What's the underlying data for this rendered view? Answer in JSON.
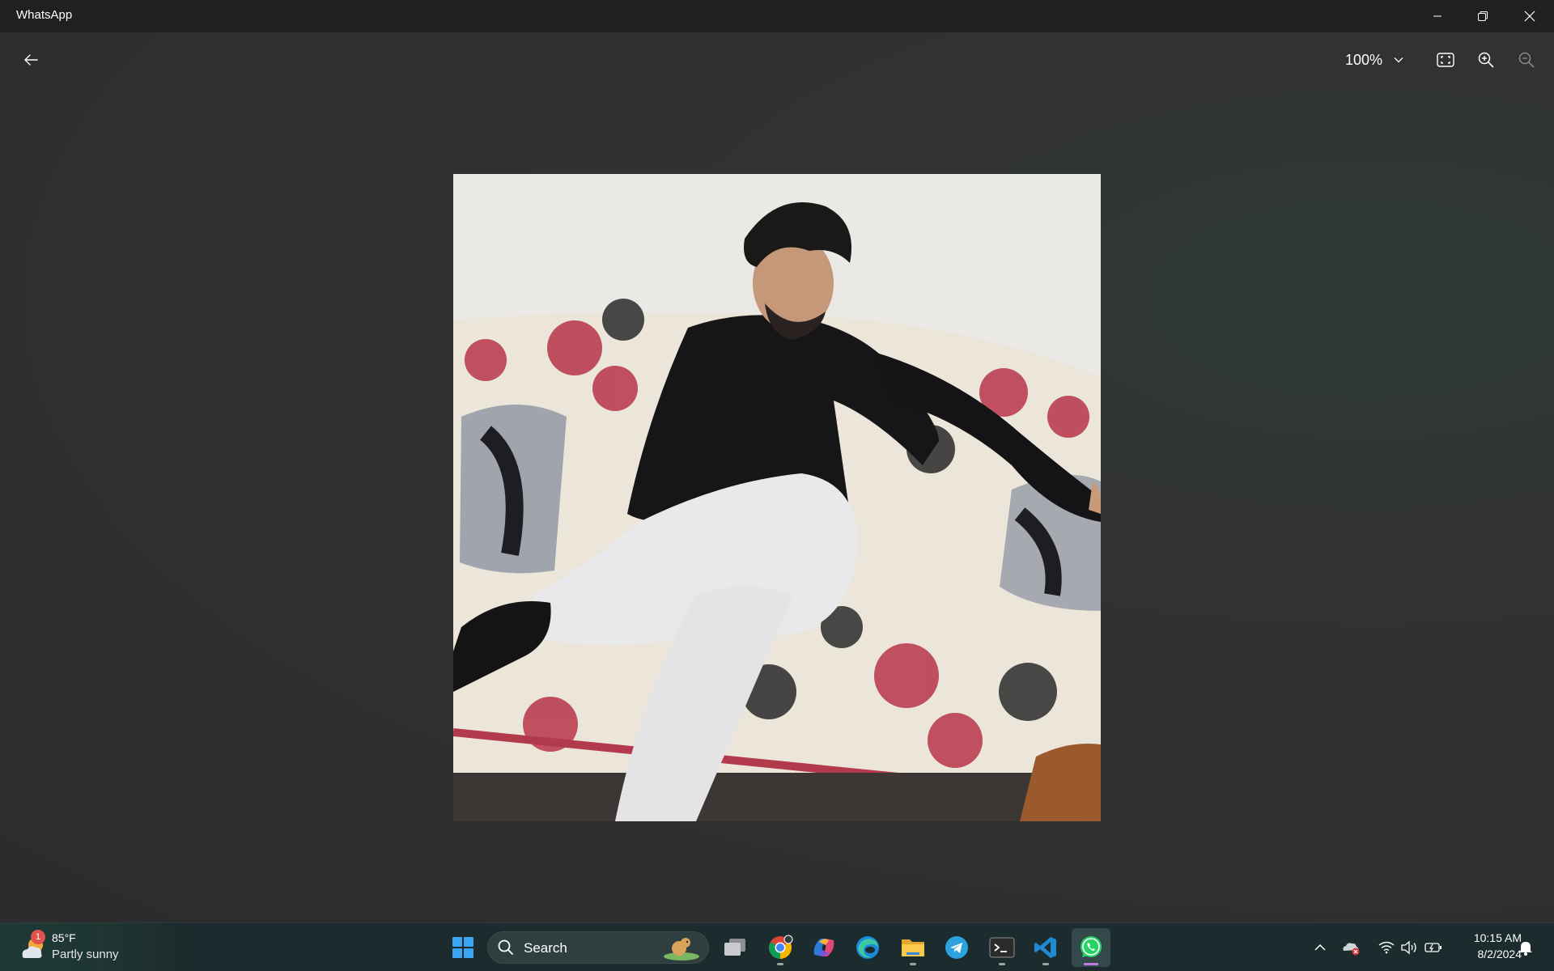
{
  "app": {
    "title": "WhatsApp"
  },
  "window_controls": {
    "minimize": "minimize-icon",
    "maximize": "restore-icon",
    "close": "close-icon"
  },
  "viewer": {
    "back_icon": "back-arrow-icon",
    "zoom_level": "100%",
    "fit_icon": "fit-to-window-icon",
    "zoom_in_icon": "zoom-in-icon",
    "zoom_out_icon": "zoom-out-icon",
    "photo": "photo of a man in a black shirt and white trousers sitting cross-legged on a sofa with a red and black floral tree-print cover"
  },
  "taskbar": {
    "weather": {
      "temperature": "85°F",
      "condition": "Partly sunny",
      "badge": "1"
    },
    "search": {
      "label": "Search"
    },
    "apps": [
      {
        "name": "start-icon"
      },
      {
        "name": "task-view-icon"
      },
      {
        "name": "chrome-icon"
      },
      {
        "name": "copilot-icon"
      },
      {
        "name": "edge-icon"
      },
      {
        "name": "file-explorer-icon"
      },
      {
        "name": "telegram-icon"
      },
      {
        "name": "terminal-icon"
      },
      {
        "name": "vscode-icon"
      },
      {
        "name": "whatsapp-icon"
      }
    ],
    "tray": {
      "chevron": "chevron-up-icon",
      "cloud": "onedrive-error-icon",
      "wifi": "wifi-icon",
      "volume": "volume-icon",
      "battery": "battery-icon",
      "notifications": "bell-icon"
    },
    "clock": {
      "time": "10:15 AM",
      "date": "8/2/2024"
    }
  },
  "colors": {
    "titlebar": "#202020",
    "viewer_bg": "#303030",
    "taskbar": "#1c2b2d",
    "accent_whatsapp": "#25d366"
  }
}
